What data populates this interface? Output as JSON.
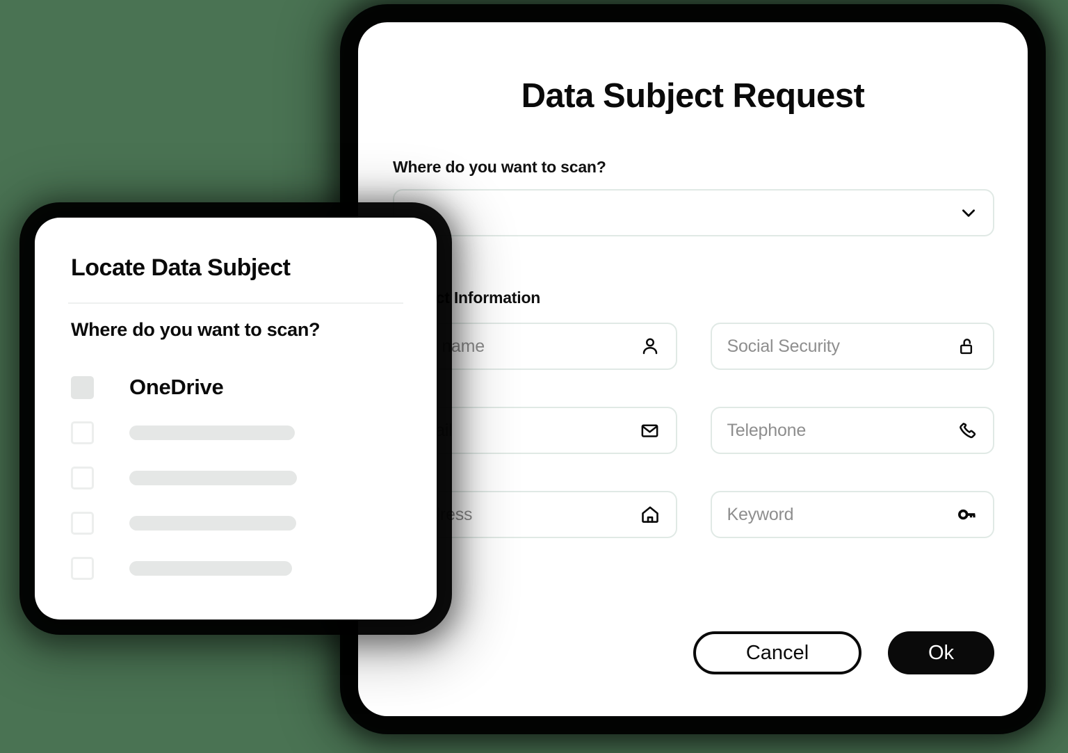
{
  "background_color": "#4a7353",
  "dsr_dialog": {
    "title": "Data Subject Request",
    "scan_label": "Where do you want to scan?",
    "scan_select": {
      "value": "",
      "placeholder": "",
      "chevron_icon": "chevron-down-icon"
    },
    "subject_section_label": "Subject Information",
    "fields": [
      {
        "name": "full-name",
        "placeholder": "Full name",
        "value": "",
        "icon": "person-icon"
      },
      {
        "name": "social-security",
        "placeholder": "Social Security",
        "value": "",
        "icon": "unlocked-padlock-icon"
      },
      {
        "name": "email",
        "placeholder": "Email",
        "value": "",
        "icon": "envelope-icon"
      },
      {
        "name": "telephone",
        "placeholder": "Telephone",
        "value": "",
        "icon": "phone-icon"
      },
      {
        "name": "address",
        "placeholder": "Address",
        "value": "",
        "icon": "home-icon"
      },
      {
        "name": "keyword",
        "placeholder": "Keyword",
        "value": "",
        "icon": "key-icon"
      }
    ],
    "cancel_label": "Cancel",
    "ok_label": "Ok",
    "accent_color": "#0a0a0a",
    "field_border_color": "#e0e9e5",
    "placeholder_color": "#8e8e8e"
  },
  "lds_dialog": {
    "title": "Locate Data Subject",
    "subtitle": "Where do you want to scan?",
    "items": [
      {
        "label": "OneDrive",
        "checked": true,
        "skeleton": false,
        "skeleton_width": 0
      },
      {
        "label": "",
        "checked": false,
        "skeleton": true,
        "skeleton_width": 238
      },
      {
        "label": "",
        "checked": false,
        "skeleton": true,
        "skeleton_width": 241
      },
      {
        "label": "",
        "checked": false,
        "skeleton": true,
        "skeleton_width": 240
      },
      {
        "label": "",
        "checked": false,
        "skeleton": true,
        "skeleton_width": 234
      }
    ],
    "checkbox_filled_color": "#e3e5e4",
    "checkbox_empty_border_color": "#eceeed",
    "skeleton_color": "#e5e7e6"
  }
}
